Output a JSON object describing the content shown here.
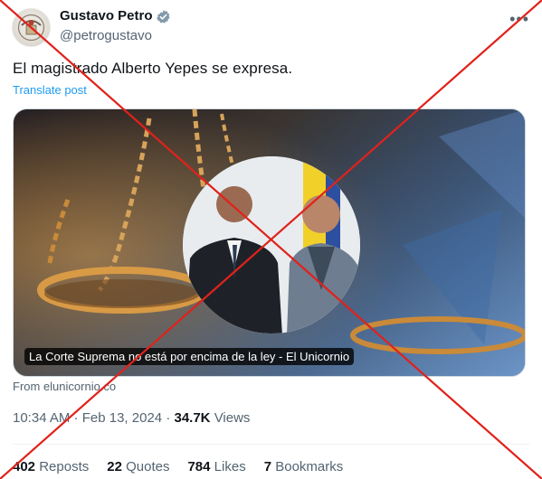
{
  "author": {
    "name": "Gustavo Petro",
    "handle": "@petrogustavo",
    "verified_icon": "verified-badge-icon"
  },
  "post": {
    "text": "El magistrado Alberto Yepes se expresa.",
    "translate_label": "Translate post"
  },
  "card": {
    "title": "La Corte Suprema no está por encima de la ley - El Unicornio",
    "source": "From elunicornio.co"
  },
  "meta": {
    "time": "10:34 AM",
    "separator": "·",
    "date": "Feb 13, 2024",
    "views_count": "34.7K",
    "views_label": "Views"
  },
  "stats": {
    "reposts_count": "402",
    "reposts_label": "Reposts",
    "quotes_count": "22",
    "quotes_label": "Quotes",
    "likes_count": "784",
    "likes_label": "Likes",
    "bookmarks_count": "7",
    "bookmarks_label": "Bookmarks"
  },
  "overlay": {
    "color": "#e0221b",
    "icon": "red-x-cross-icon"
  },
  "colors": {
    "link": "#1d9bf0",
    "secondary_text": "#536471",
    "primary_text": "#0f1419"
  }
}
